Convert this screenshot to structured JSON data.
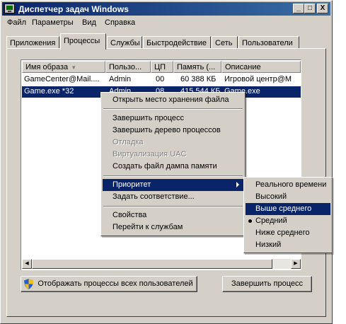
{
  "window": {
    "title": "Диспетчер задач Windows",
    "controls": {
      "minimize": "_",
      "maximize": "□",
      "close": "X"
    }
  },
  "menu": [
    "Файл",
    "Параметры",
    "Вид",
    "Справка"
  ],
  "tabs": [
    "Приложения",
    "Процессы",
    "Службы",
    "Быстродействие",
    "Сеть",
    "Пользователи"
  ],
  "active_tab": "Процессы",
  "process_list": {
    "columns": [
      "Имя образа",
      "Пользо...",
      "ЦП",
      "Память (...",
      "Описание"
    ],
    "sort_indicator": "▼",
    "rows": [
      {
        "name": "GameCenter@Mail....",
        "user": "Admin",
        "cpu": "00",
        "memory": "60 388 КБ",
        "description": "Игровой центр@M"
      },
      {
        "name": "Game.exe *32",
        "user": "Admin",
        "cpu": "08",
        "memory": "415 544 КБ",
        "description": "Game.exe"
      }
    ]
  },
  "buttons": {
    "show_all": "Отображать процессы всех пользователей",
    "end_process": "Завершить процесс"
  },
  "context_menu": {
    "items": [
      {
        "label": "Открыть место хранения файла",
        "enabled": true
      },
      {
        "label": "Завершить процесс",
        "enabled": true
      },
      {
        "label": "Завершить дерево процессов",
        "enabled": true
      },
      {
        "label": "Отладка",
        "enabled": false
      },
      {
        "label": "Виртуализация UAC",
        "enabled": false
      },
      {
        "label": "Создать файл дампа памяти",
        "enabled": true
      },
      {
        "label": "Приоритет",
        "enabled": true,
        "submenu": true
      },
      {
        "label": "Задать соответствие...",
        "enabled": true
      },
      {
        "label": "Свойства",
        "enabled": true
      },
      {
        "label": "Перейти к службам",
        "enabled": true
      }
    ]
  },
  "priority_submenu": {
    "items": [
      "Реального времени",
      "Высокий",
      "Выше среднего",
      "Средний",
      "Ниже среднего",
      "Низкий"
    ],
    "highlighted": "Выше среднего",
    "checked": "Средний"
  },
  "colors": {
    "selection": "#0a246a",
    "face": "#d4d0c8"
  }
}
